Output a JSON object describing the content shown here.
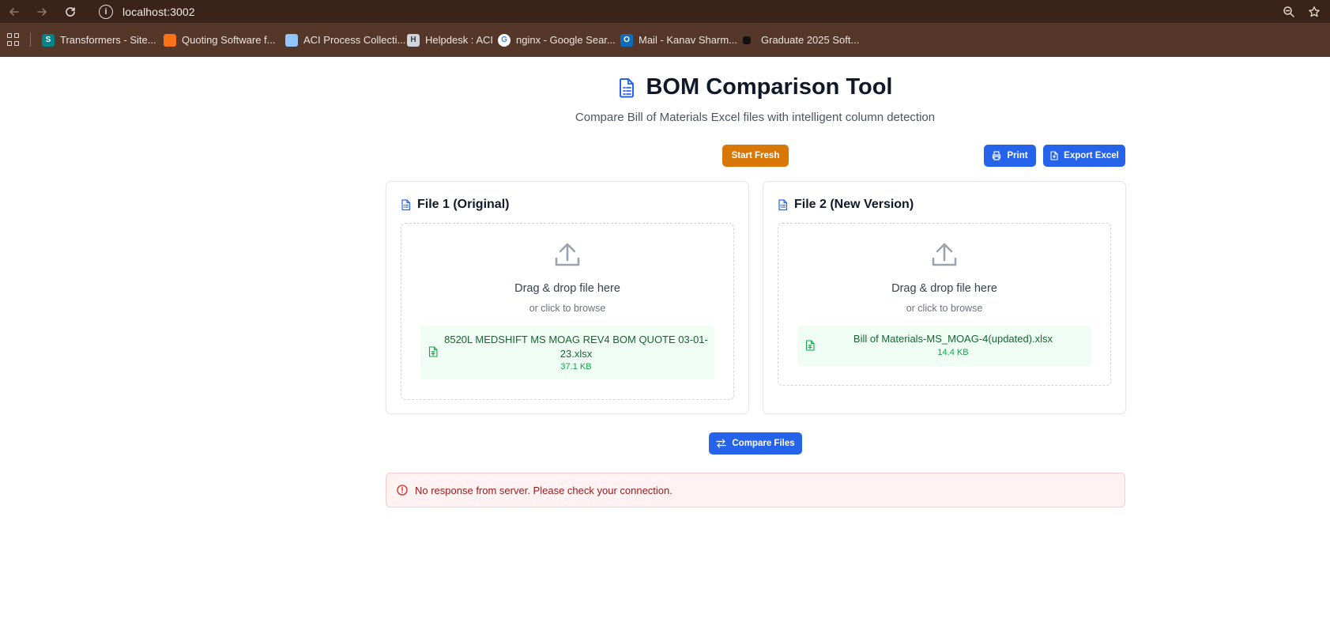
{
  "browser": {
    "url": "localhost:3002",
    "bookmarks": [
      {
        "label": "Transformers - Site...",
        "icon": "sharepoint-icon",
        "color": "#038387"
      },
      {
        "label": "Quoting Software f...",
        "icon": "box-icon",
        "color": "#f97316"
      },
      {
        "label": "ACI Process Collecti...",
        "icon": "cloud-icon",
        "color": "#60a5fa"
      },
      {
        "label": "Helpdesk : ACI",
        "icon": "helpdesk-icon",
        "color": "#9ca3af"
      },
      {
        "label": "nginx - Google Sear...",
        "icon": "google-icon",
        "color": "#ffffff"
      },
      {
        "label": "Mail - Kanav Sharm...",
        "icon": "outlook-icon",
        "color": "#0f6cbd"
      },
      {
        "label": "Graduate 2025 Soft...",
        "icon": "square-icon",
        "color": "#111111"
      }
    ]
  },
  "header": {
    "title": "BOM Comparison Tool",
    "subtitle": "Compare Bill of Materials Excel files with intelligent column detection"
  },
  "actions": {
    "start_fresh": "Start Fresh",
    "print": "Print",
    "export_excel": "Export Excel",
    "compare": "Compare Files"
  },
  "file1": {
    "title": "File 1 (Original)",
    "drop_text": "Drag & drop file here",
    "browse_text": "or click to browse",
    "file_name": "8520L MEDSHIFT MS MOAG REV4 BOM QUOTE 03-01-23.xlsx",
    "file_size": "37.1 KB"
  },
  "file2": {
    "title": "File 2 (New Version)",
    "drop_text": "Drag & drop file here",
    "browse_text": "or click to browse",
    "file_name": "Bill of Materials-MS_MOAG-4(updated).xlsx",
    "file_size": "14.4 KB"
  },
  "error": {
    "message": "No response from server. Please check your connection."
  },
  "colors": {
    "primary": "#2563eb",
    "warning": "#d97706",
    "success_bg": "#f0fdf4",
    "error_bg": "#fef2f2"
  }
}
